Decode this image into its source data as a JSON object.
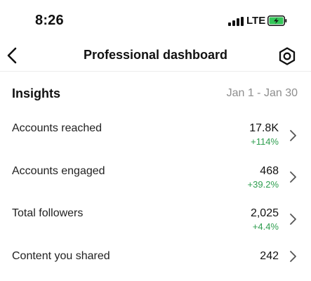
{
  "status_bar": {
    "time": "8:26",
    "network": "LTE",
    "battery_color": "#34c759"
  },
  "nav": {
    "title": "Professional dashboard"
  },
  "insights": {
    "title": "Insights",
    "date_range": "Jan 1 - Jan 30"
  },
  "metrics": [
    {
      "label": "Accounts reached",
      "value": "17.8K",
      "change": "+114%"
    },
    {
      "label": "Accounts engaged",
      "value": "468",
      "change": "+39.2%"
    },
    {
      "label": "Total followers",
      "value": "2,025",
      "change": "+4.4%"
    },
    {
      "label": "Content you shared",
      "value": "242",
      "change": ""
    }
  ],
  "colors": {
    "positive_change": "#2e9e4f",
    "secondary_text": "#8e8e8e"
  },
  "icons": {
    "back": "chevron-left-icon",
    "settings": "gear-icon",
    "row": "chevron-right-icon"
  }
}
